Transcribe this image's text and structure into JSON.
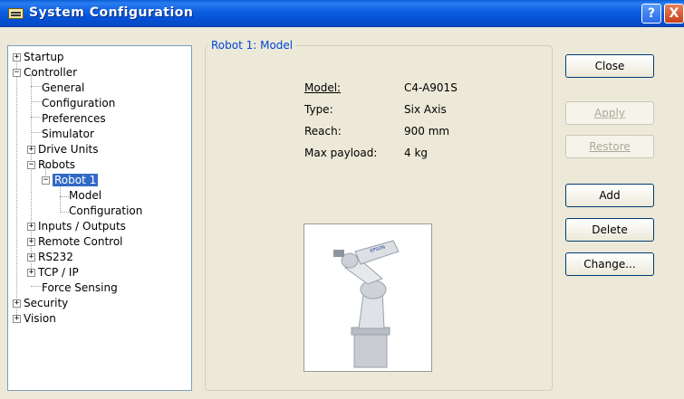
{
  "window": {
    "title": "System Configuration",
    "help_glyph": "?",
    "close_glyph": "X"
  },
  "tree": {
    "items": [
      {
        "label": "Startup",
        "expander": "+"
      },
      {
        "label": "Controller",
        "expander": "−"
      },
      {
        "label": "General"
      },
      {
        "label": "Configuration"
      },
      {
        "label": "Preferences"
      },
      {
        "label": "Simulator"
      },
      {
        "label": "Drive Units",
        "expander": "+"
      },
      {
        "label": "Robots",
        "expander": "−"
      },
      {
        "label": "Robot 1",
        "expander": "−",
        "selected": true
      },
      {
        "label": "Model"
      },
      {
        "label": "Configuration"
      },
      {
        "label": "Inputs / Outputs",
        "expander": "+"
      },
      {
        "label": "Remote Control",
        "expander": "+"
      },
      {
        "label": "RS232",
        "expander": "+"
      },
      {
        "label": "TCP / IP",
        "expander": "+"
      },
      {
        "label": "Force Sensing"
      },
      {
        "label": "Security",
        "expander": "+"
      },
      {
        "label": "Vision",
        "expander": "+"
      }
    ]
  },
  "panel": {
    "title": "Robot 1: Model",
    "properties": [
      {
        "label": "Model:",
        "value": "C4-A901S"
      },
      {
        "label": "Type:",
        "value": "Six Axis"
      },
      {
        "label": "Reach:",
        "value": "900 mm"
      },
      {
        "label": "Max payload:",
        "value": "4 kg"
      }
    ],
    "image_brand": "EPSON"
  },
  "buttons": {
    "close": "Close",
    "apply": "Apply",
    "restore": "Restore",
    "add": "Add",
    "delete": "Delete",
    "change": "Change..."
  },
  "colors": {
    "titlebar": "#0a5fd8",
    "selection": "#316ac5",
    "group_title": "#0046d5"
  }
}
